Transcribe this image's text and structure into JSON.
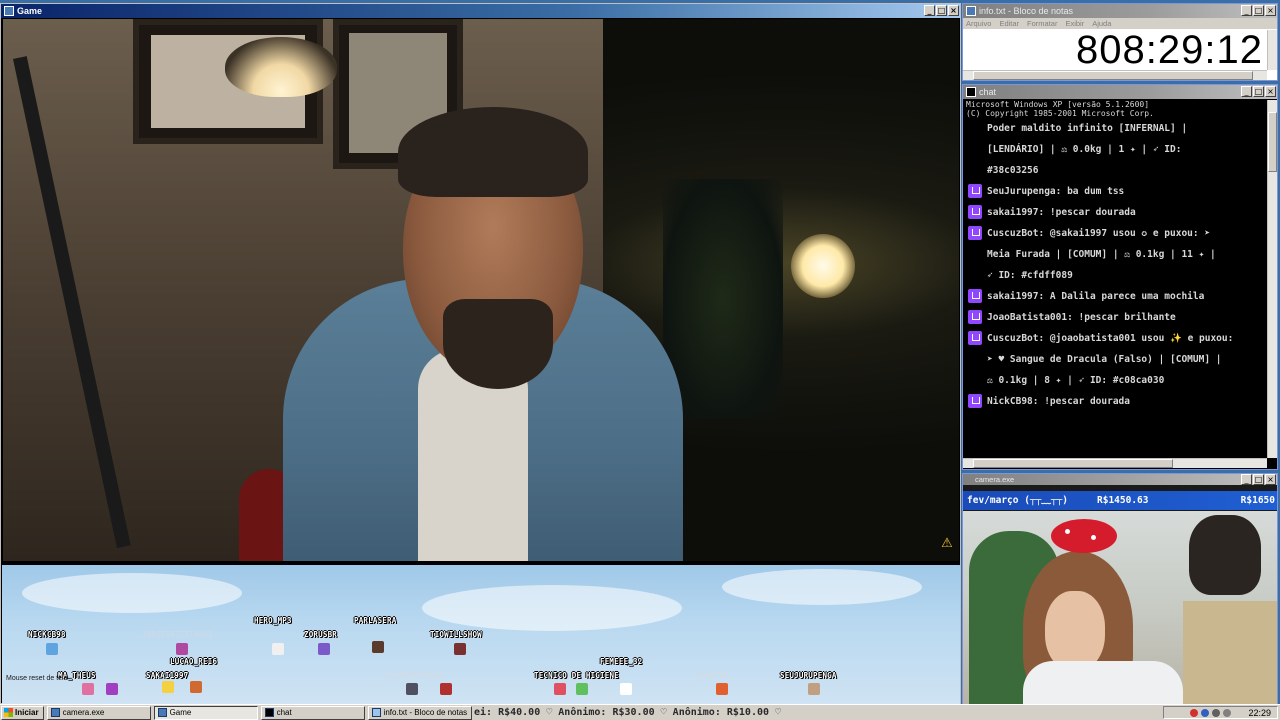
{
  "game_window": {
    "title": "Game",
    "overlay": {
      "note": "Mouse reset de tela",
      "users": [
        {
          "name": "NICKCB98",
          "faded": false
        },
        {
          "name": "JORGEBATISTA001",
          "faded": true
        },
        {
          "name": "HERO_MP3",
          "faded": false
        },
        {
          "name": "PARLASERA",
          "faded": false
        },
        {
          "name": "TIOWILLSHOW",
          "faded": false
        },
        {
          "name": "ZORUSBR",
          "faded": false
        },
        {
          "name": "LUCAO_REI6",
          "faded": false
        },
        {
          "name": "MA_THEUS",
          "faded": false
        },
        {
          "name": "SAKAI1997",
          "faded": false
        },
        {
          "name": "FEMEEE_32",
          "faded": false
        },
        {
          "name": "TECNICO DE HIGIENE",
          "faded": false
        },
        {
          "name": "SEUJURUPENGA",
          "faded": false
        },
        {
          "name": "ANONIMO",
          "faded": true
        },
        {
          "name": "SKINKKRASADA",
          "faded": true
        }
      ]
    }
  },
  "notepad": {
    "title": "info.txt - Bloco de notas",
    "menu": [
      "Arquivo",
      "Editar",
      "Formatar",
      "Exibir",
      "Ajuda"
    ],
    "timer": "808:29:12"
  },
  "chat": {
    "title": "chat",
    "header": [
      "Microsoft Windows XP [versão 5.1.2600]",
      "(C) Copyright 1985-2001 Microsoft Corp."
    ],
    "lines": [
      {
        "kind": "cont",
        "text": "Poder maldito infinito [INFERNAL] |"
      },
      {
        "kind": "cont",
        "text": "[LENDÁRIO] | ⚖ 0.0kg | 1 ✦ | ➶ ID:"
      },
      {
        "kind": "cont",
        "text": "#38c03256"
      },
      {
        "kind": "msg",
        "text": "SeuJurupenga: ba dum tss"
      },
      {
        "kind": "msg",
        "text": "sakai1997: !pescar dourada"
      },
      {
        "kind": "msg",
        "text": "CuscuzBot: @sakai1997 usou ✪ e puxou: ➤"
      },
      {
        "kind": "cont",
        "text": "Meia Furada | [COMUM] | ⚖ 0.1kg | 11 ✦ |"
      },
      {
        "kind": "cont",
        "text": "➶ ID: #cfdff089"
      },
      {
        "kind": "msg",
        "text": "sakai1997: A Dalila parece uma mochila"
      },
      {
        "kind": "msg",
        "text": "JoaoBatista001: !pescar brilhante"
      },
      {
        "kind": "msg",
        "text": "CuscuzBot: @joaobatista001 usou ✨ e puxou:"
      },
      {
        "kind": "cont",
        "text": "➤ ♥ Sangue de Dracula (Falso) | [COMUM] |"
      },
      {
        "kind": "cont",
        "text": "⚖ 0.1kg | 8 ✦ | ➶ ID: #c08ca030"
      },
      {
        "kind": "msg",
        "text": "NickCB98: !pescar dourada"
      }
    ]
  },
  "camera": {
    "title": "camera.exe",
    "goal_title": "fev/março (┬┬﹏┬┬)",
    "goal_current": "R$1450.63",
    "goal_target": "R$1650"
  },
  "taskbar": {
    "start_label": "Iniciar",
    "tasks": [
      {
        "label": "camera.exe",
        "active": false
      },
      {
        "label": "Game",
        "active": true
      },
      {
        "label": "chat",
        "active": false
      },
      {
        "label": "info.txt - Bloco de notas",
        "active": false
      }
    ],
    "ticker": "ei: R$40.00 ♡ Anônimo: R$30.00 ♡ Anônimo: R$10.00 ♡",
    "clock": "22:29"
  }
}
